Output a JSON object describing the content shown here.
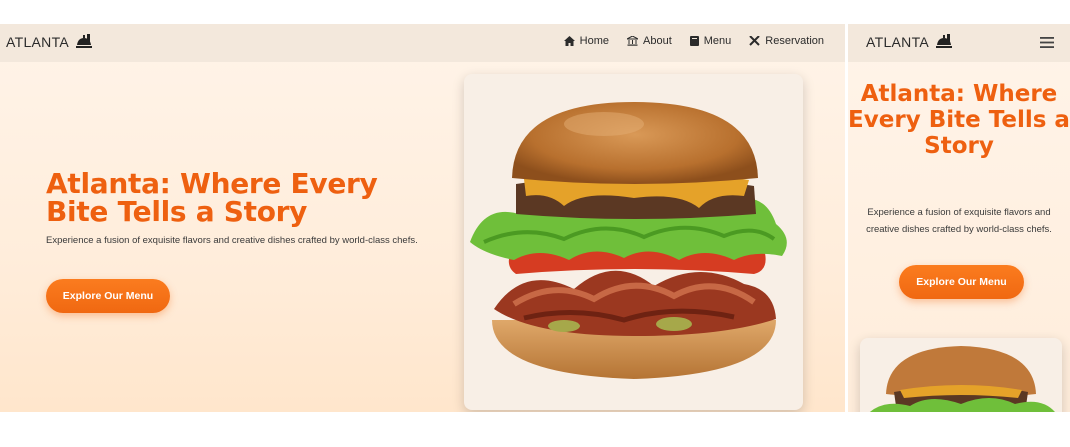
{
  "desktop": {
    "brand": "ATLANTA",
    "nav": [
      {
        "label": "Home",
        "icon": "home-icon"
      },
      {
        "label": "About",
        "icon": "bank-icon"
      },
      {
        "label": "Menu",
        "icon": "book-icon"
      },
      {
        "label": "Reservation",
        "icon": "utensils-icon"
      }
    ],
    "hero": {
      "title": "Atlanta: Where Every Bite Tells a Story",
      "subtitle": "Experience a fusion of exquisite flavors and creative dishes crafted by world-class chefs.",
      "cta": "Explore Our Menu"
    }
  },
  "mobile": {
    "brand": "ATLANTA",
    "menu_icon": "hamburger-icon",
    "hero": {
      "title": "Atlanta: Where Every Bite Tells a Story",
      "subtitle": "Experience a fusion of exquisite flavors and creative dishes crafted by world-class chefs.",
      "cta": "Explore Our Menu"
    }
  },
  "colors": {
    "accent": "#ee6010",
    "button": "#f06811",
    "nav_bg": "#f3e8dc",
    "hero_bg": "#fff1e3"
  }
}
